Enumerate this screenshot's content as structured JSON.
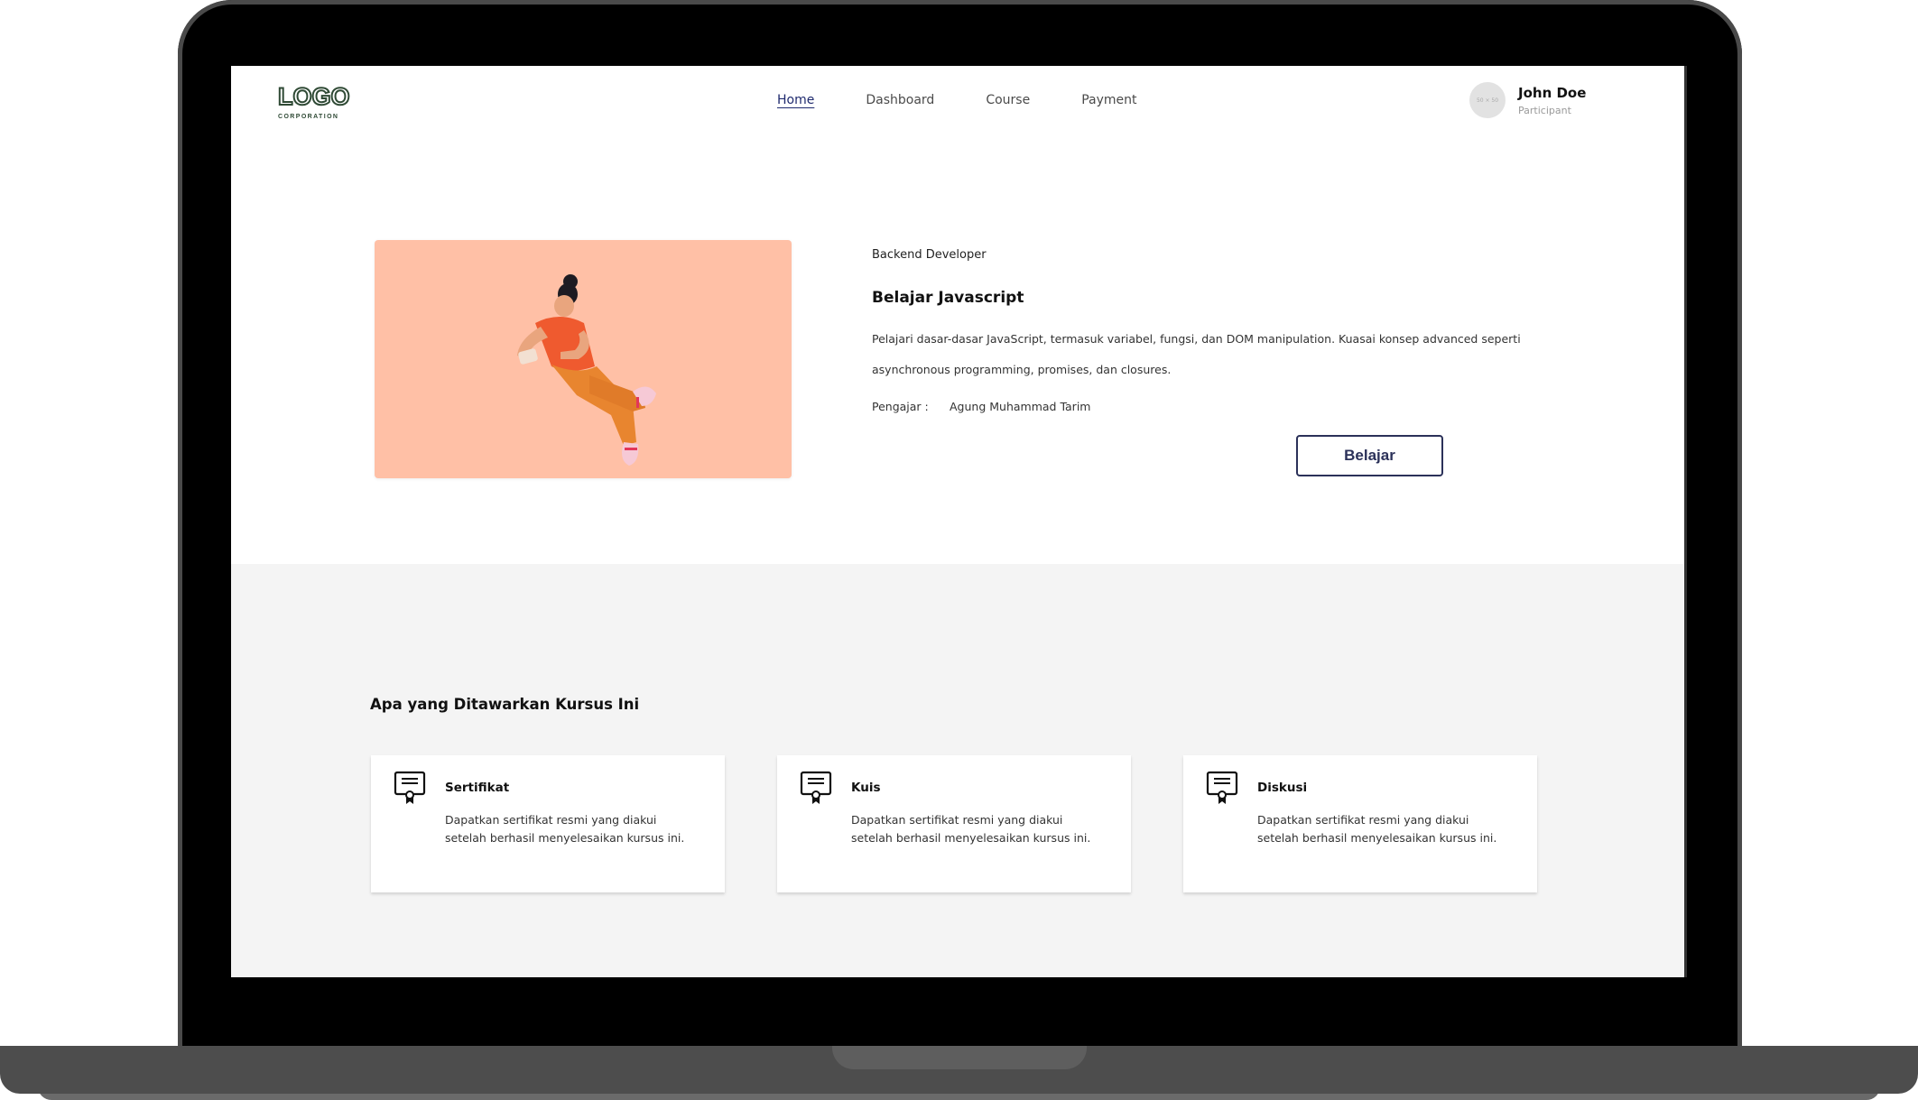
{
  "navbar": {
    "logo_text": "LOGO",
    "logo_subtext": "CORPORATION",
    "items": [
      {
        "label": "Home",
        "active": true
      },
      {
        "label": "Dashboard",
        "active": false
      },
      {
        "label": "Course",
        "active": false
      },
      {
        "label": "Payment",
        "active": false
      }
    ],
    "user": {
      "avatar_text": "50 × 50",
      "name": "John Doe",
      "role": "Participant"
    }
  },
  "hero": {
    "illustration": "person-with-phone-illustration",
    "category": "Backend Developer",
    "title": "Belajar Javascript",
    "description": "Pelajari dasar-dasar JavaScript, termasuk variabel, fungsi, dan DOM manipulation. Kuasai konsep advanced seperti asynchronous programming, promises, dan closures.",
    "teacher_label": "Pengajar :",
    "teacher_name": "Agung Muhammad Tarim",
    "button_label": "Belajar"
  },
  "offerings": {
    "heading": "Apa yang Ditawarkan Kursus Ini",
    "cards": [
      {
        "icon": "certificate-icon",
        "title": "Sertifikat",
        "description": "Dapatkan sertifikat resmi yang diakui setelah berhasil menyelesaikan kursus ini."
      },
      {
        "icon": "certificate-icon",
        "title": "Kuis",
        "description": "Dapatkan sertifikat resmi yang diakui setelah berhasil menyelesaikan kursus ini."
      },
      {
        "icon": "certificate-icon",
        "title": "Diskusi",
        "description": "Dapatkan sertifikat resmi yang diakui setelah berhasil menyelesaikan kursus ini."
      }
    ]
  },
  "colors": {
    "hero_bg": "#ffc0a6",
    "button_border": "#2b3159",
    "active_nav": "#1f2a6e",
    "section_bg": "#f4f4f4"
  }
}
